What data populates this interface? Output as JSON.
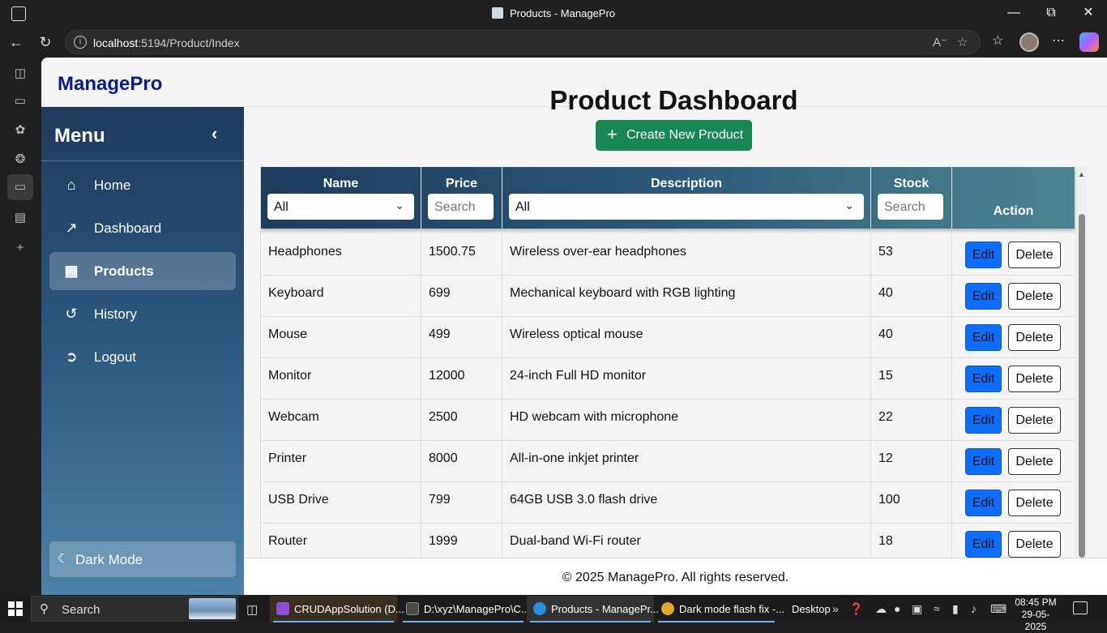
{
  "browser": {
    "window_title": "Products - ManagePro",
    "url_host": "localhost",
    "url_rest": ":5194/Product/Index"
  },
  "app": {
    "brand": "ManagePro",
    "page_title": "Product Dashboard",
    "create_button": "Create New Product",
    "footer": "© 2025 ManagePro. All rights reserved."
  },
  "sidebar": {
    "title": "Menu",
    "items": [
      {
        "label": "Home",
        "icon": "home-icon"
      },
      {
        "label": "Dashboard",
        "icon": "chart-line-icon"
      },
      {
        "label": "Products",
        "icon": "boxes-icon",
        "active": true
      },
      {
        "label": "History",
        "icon": "history-icon"
      },
      {
        "label": "Logout",
        "icon": "logout-icon"
      }
    ],
    "dark_mode_label": "Dark Mode"
  },
  "table": {
    "headers": {
      "name": "Name",
      "price": "Price",
      "description": "Description",
      "stock": "Stock",
      "action": "Action"
    },
    "filters": {
      "name_selected": "All",
      "price_placeholder": "Search",
      "description_selected": "All",
      "stock_placeholder": "Search"
    },
    "edit_label": "Edit",
    "delete_label": "Delete",
    "rows": [
      {
        "name": "Headphones",
        "price": "1500.75",
        "description": "Wireless over-ear headphones",
        "stock": "53"
      },
      {
        "name": "Keyboard",
        "price": "699",
        "description": "Mechanical keyboard with RGB lighting",
        "stock": "40"
      },
      {
        "name": "Mouse",
        "price": "499",
        "description": "Wireless optical mouse",
        "stock": "40"
      },
      {
        "name": "Monitor",
        "price": "12000",
        "description": "24-inch Full HD monitor",
        "stock": "15"
      },
      {
        "name": "Webcam",
        "price": "2500",
        "description": "HD webcam with microphone",
        "stock": "22"
      },
      {
        "name": "Printer",
        "price": "8000",
        "description": "All-in-one inkjet printer",
        "stock": "12"
      },
      {
        "name": "USB Drive",
        "price": "799",
        "description": "64GB USB 3.0 flash drive",
        "stock": "100"
      },
      {
        "name": "Router",
        "price": "1999",
        "description": "Dual-band Wi-Fi router",
        "stock": "18"
      }
    ]
  },
  "taskbar": {
    "search_label": "Search",
    "apps": [
      {
        "label": "CRUDAppSolution (D...",
        "color": "#8a4fd6"
      },
      {
        "label": "D:\\xyz\\ManagePro\\C...",
        "color": "#4a4a4a"
      },
      {
        "label": "Products - ManagePr...",
        "color": "#2b8fe0"
      },
      {
        "label": "Dark mode flash fix -...",
        "color": "#e0a82b"
      }
    ],
    "desktop_label": "Desktop",
    "time": "08:45 PM",
    "date": "29-05-2025"
  }
}
